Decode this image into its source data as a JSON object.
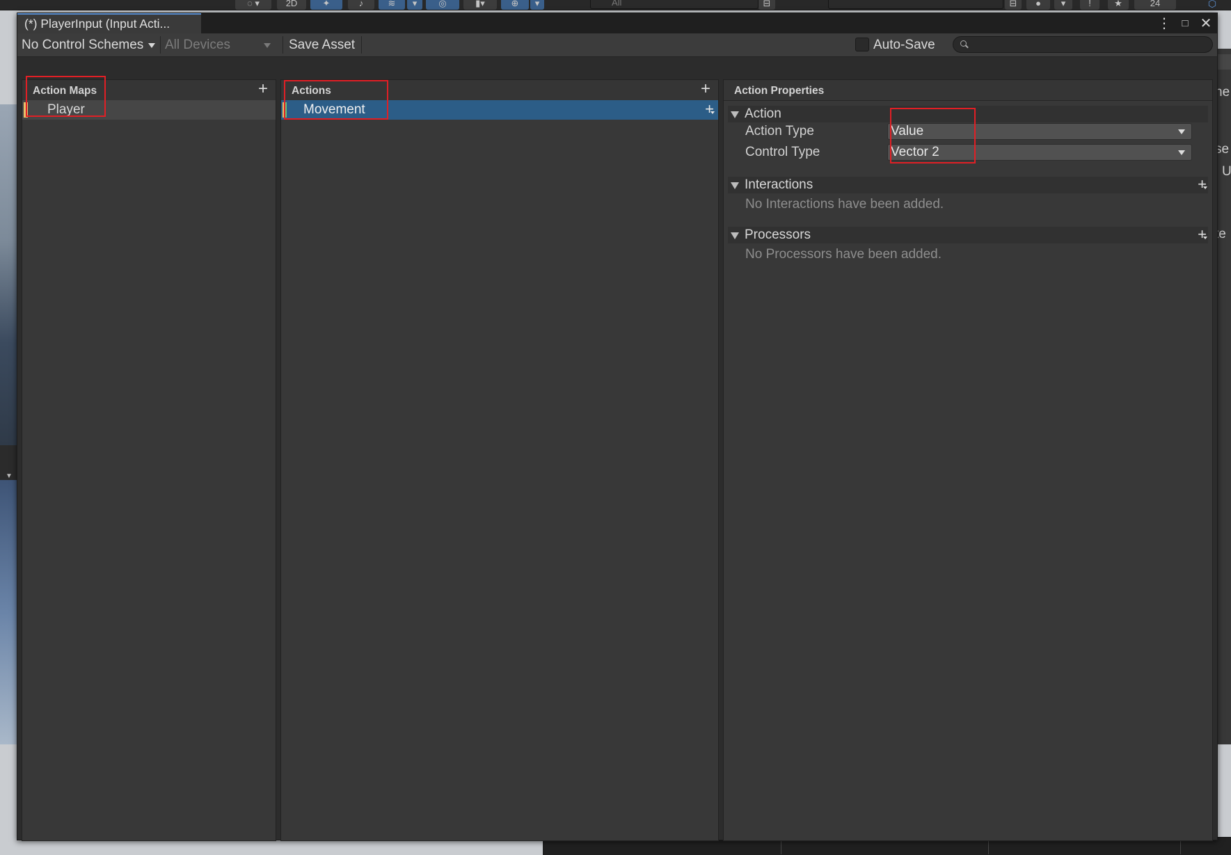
{
  "window": {
    "tab_title": "(*) PlayerInput (Input Acti..."
  },
  "toolbar": {
    "control_schemes": "No Control Schemes",
    "devices": "All Devices",
    "save_asset": "Save Asset",
    "auto_save_label": "Auto-Save",
    "auto_save_checked": false,
    "search_placeholder": ""
  },
  "action_maps": {
    "title": "Action Maps",
    "items": [
      {
        "label": "Player",
        "selected": false
      }
    ]
  },
  "actions": {
    "title": "Actions",
    "items": [
      {
        "label": "Movement",
        "selected": true
      }
    ]
  },
  "properties": {
    "title": "Action Properties",
    "action_section": {
      "title": "Action",
      "action_type_label": "Action Type",
      "action_type_value": "Value",
      "control_type_label": "Control Type",
      "control_type_value": "Vector 2"
    },
    "interactions": {
      "title": "Interactions",
      "empty_text": "No Interactions have been added."
    },
    "processors": {
      "title": "Processors",
      "empty_text": "No Processors have been added."
    }
  },
  "background_editor": {
    "toolbar_2d_label": "2D",
    "search_hint": "All",
    "count_badge": "24",
    "side_text_1": "ne",
    "side_text_2": "se",
    "side_text_3": "U",
    "side_text_4": "te"
  },
  "colors": {
    "selection": "#2c5d87",
    "highlight": "#e11f25",
    "accent_tab": "#5a8fd0",
    "action_map_marker": "#e8c06b"
  }
}
